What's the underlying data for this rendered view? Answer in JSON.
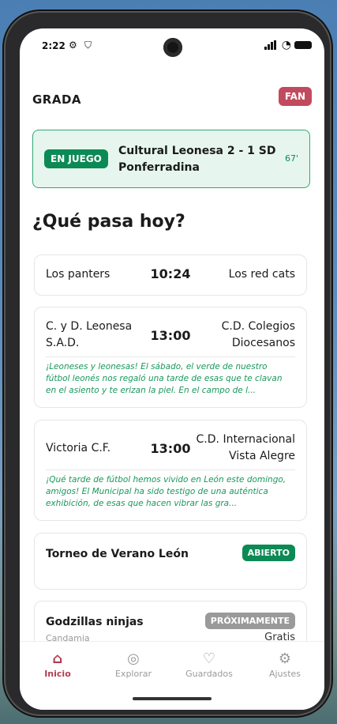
{
  "status": {
    "time": "2:22"
  },
  "header": {
    "brand": "GRADA",
    "role_badge": "FAN"
  },
  "live_match": {
    "badge": "EN JUEGO",
    "title": "Cultural Leonesa 2 - 1 SD Ponferradina",
    "minute": "67'"
  },
  "section_title": "¿Qué pasa hoy?",
  "matches": [
    {
      "home": "Los panters",
      "time": "10:24",
      "away": "Los red cats"
    },
    {
      "home": "C. y D. Leonesa S.A.D.",
      "time": "13:00",
      "away": "C.D. Colegios Diocesanos",
      "preview": "¡Leoneses y leonesas! El sábado, el verde de nuestro fútbol leonés nos regaló una tarde de esas que te clavan en el asiento y te erizan la piel. En el campo de l..."
    },
    {
      "home": "Victoria C.F.",
      "time": "13:00",
      "away": "C.D. Internacional Vista Alegre",
      "preview": "¡Qué tarde de fútbol hemos vivido en León este domingo, amigos! El Municipal ha sido testigo de una auténtica exhibición, de esas que hacen vibrar las gra..."
    }
  ],
  "tournaments": [
    {
      "name": "Torneo de Verano León",
      "status": "ABIERTO"
    },
    {
      "name": "Godzillas ninjas",
      "status": "PRÓXIMAMENTE",
      "location": "Candamia",
      "price": "Gratis"
    }
  ],
  "nav": [
    {
      "label": "Inicio",
      "icon": "home-icon",
      "active": true
    },
    {
      "label": "Explorar",
      "icon": "compass-icon",
      "active": false
    },
    {
      "label": "Guardados",
      "icon": "heart-icon",
      "active": false
    },
    {
      "label": "Ajustes",
      "icon": "gear-icon",
      "active": false
    }
  ],
  "colors": {
    "brand_red": "#c24a5e",
    "live_green": "#0c8a55",
    "live_bg": "#e6f6ee"
  }
}
